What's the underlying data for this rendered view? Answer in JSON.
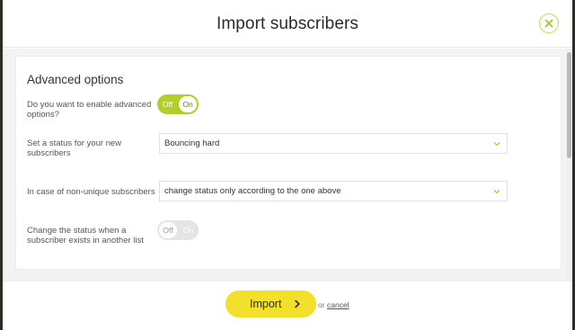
{
  "modal": {
    "title": "Import subscribers",
    "close_icon": "close-icon",
    "accent_color": "#b3cd2a"
  },
  "advanced": {
    "title": "Advanced options",
    "rows": [
      {
        "label": "Do you want to enable advanced options?",
        "toggle": {
          "off": "Off",
          "on": "On",
          "state": "off"
        }
      },
      {
        "label": "Set a status for your new subscribers",
        "select_value": "Bouncing hard"
      },
      {
        "label": "In case of non-unique subscribers",
        "select_value": "change status only according to the one above"
      },
      {
        "label": "Change the status when a subscriber exists in another list",
        "toggle": {
          "off": "Off",
          "on": "On",
          "state": "off"
        }
      }
    ]
  },
  "footer": {
    "import_label": "Import",
    "import_icon": "chevron-right-icon",
    "import_color": "#f2e02b",
    "or_text": "or",
    "cancel_label": "cancel"
  }
}
